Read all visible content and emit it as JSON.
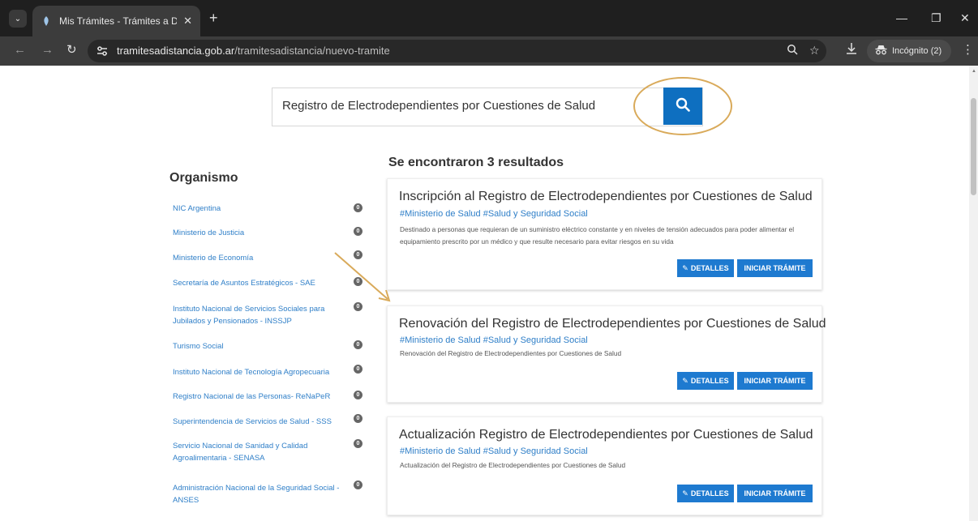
{
  "browser": {
    "tab_title": "Mis Trámites - Trámites a Distancia",
    "tab_close": "✕",
    "new_tab": "+",
    "url_host": "tramitesadistancia.gob.ar",
    "url_path": "/tramitesadistancia/nuevo-tramite",
    "incognito_label": "Incógnito (2)",
    "controls": {
      "minimize": "—",
      "restore": "❐",
      "close": "✕"
    }
  },
  "search": {
    "query": "Registro de Electrodependientes por Cuestiones de Salud"
  },
  "sidebar": {
    "title": "Organismo",
    "items": [
      {
        "label": "NIC Argentina",
        "count": "0"
      },
      {
        "label": "Ministerio de Justicia",
        "count": "0"
      },
      {
        "label": "Ministerio de Economía",
        "count": "0"
      },
      {
        "label": "Secretaría de Asuntos Estratégicos - SAE",
        "count": "0"
      },
      {
        "label": "Instituto Nacional de Servicios Sociales para Jubilados y Pensionados - INSSJP",
        "count": "0"
      },
      {
        "label": "Turismo Social",
        "count": "0"
      },
      {
        "label": "Instituto Nacional de Tecnología Agropecuaria",
        "count": "0"
      },
      {
        "label": "Registro Nacional de las Personas- ReNaPeR",
        "count": "0"
      },
      {
        "label": "Superintendencia de Servicios de Salud - SSS",
        "count": "0"
      },
      {
        "label": "Servicio Nacional de Sanidad y Calidad Agroalimentaria - SENASA",
        "count": "0"
      },
      {
        "label": "Administración Nacional de la Seguridad Social - ANSES",
        "count": "0"
      }
    ]
  },
  "results": {
    "title": "Se encontraron 3 resultados",
    "details_label": "DETALLES",
    "start_label": "INICIAR TRÁMITE",
    "items": [
      {
        "title": "Inscripción al Registro de Electrodependientes por Cuestiones de Salud",
        "tags": "#Ministerio de Salud #Salud y Seguridad Social",
        "description": "Destinado a personas que requieran de un suministro eléctrico constante y en niveles de tensión adecuados para poder alimentar el equipamiento prescrito por un médico y que resulte necesario para evitar riesgos en su vida"
      },
      {
        "title": "Renovación del Registro de Electrodependientes por Cuestiones de Salud",
        "tags": "#Ministerio de Salud #Salud y Seguridad Social",
        "description": "Renovación del Registro de Electrodependientes por Cuestiones de Salud"
      },
      {
        "title": "Actualización Registro de Electrodependientes por Cuestiones de Salud",
        "tags": "#Ministerio de Salud #Salud y Seguridad Social",
        "description": "Actualización del Registro de Electrodependientes por Cuestiones de Salud"
      }
    ]
  },
  "colors": {
    "primary": "#0e6fc0",
    "button": "#1e7ad0",
    "link": "#2f7fc8",
    "annotation": "#d9aa5a"
  }
}
